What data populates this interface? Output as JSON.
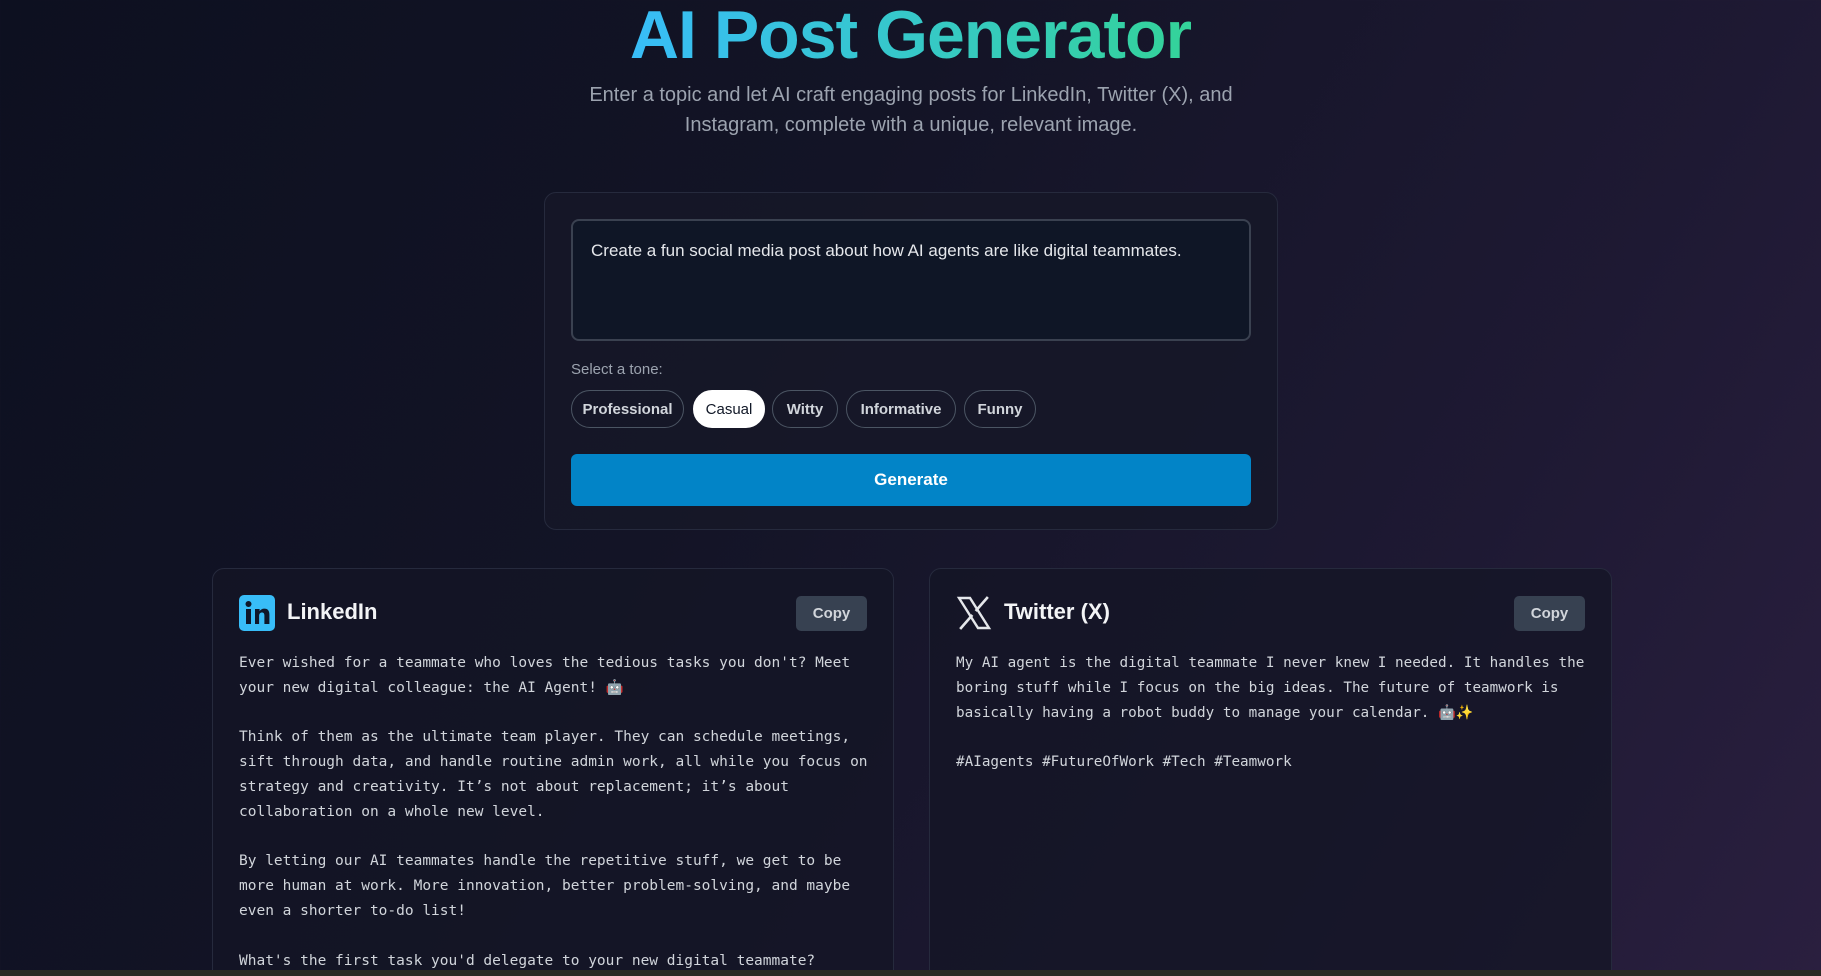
{
  "header": {
    "title": "AI Post Generator",
    "subtitle": "Enter a topic and let AI craft engaging posts for LinkedIn, Twitter (X), and Instagram, complete with a unique, relevant image."
  },
  "form": {
    "prompt_value": "Create a fun social media post about how AI agents are like digital teammates.",
    "tone_label": "Select a tone:",
    "tones": [
      "Professional",
      "Casual",
      "Witty",
      "Informative",
      "Funny"
    ],
    "selected_tone": "Casual",
    "generate_label": "Generate"
  },
  "cards": {
    "linkedin": {
      "icon": "linkedin-icon",
      "title": "LinkedIn",
      "copy_label": "Copy",
      "paragraphs": [
        "Ever wished for a teammate who loves the tedious tasks you don't? Meet your new digital colleague: the AI Agent! 🤖",
        "Think of them as the ultimate team player. They can schedule meetings, sift through data, and handle routine admin work, all while you focus on strategy and creativity. It’s not about replacement; it’s about collaboration on a whole new level.",
        "By letting our AI teammates handle the repetitive stuff, we get to be more human at work. More innovation, better problem-solving, and maybe even a shorter to-do list!",
        "What's the first task you'd delegate to your new digital teammate?"
      ]
    },
    "twitter": {
      "icon": "x-logo-icon",
      "title": "Twitter (X)",
      "copy_label": "Copy",
      "paragraphs": [
        "My AI agent is the digital teammate I never knew I needed. It handles the boring stuff while I focus on the big ideas. The future of teamwork is basically having a robot buddy to manage your calendar. 🤖✨",
        "#AIagents #FutureOfWork #Tech #Teamwork"
      ]
    }
  },
  "colors": {
    "accent": "#0284c7",
    "title_gradient_start": "#38bdf8",
    "title_gradient_end": "#34d399",
    "linkedin_brand": "#38bdf8"
  }
}
